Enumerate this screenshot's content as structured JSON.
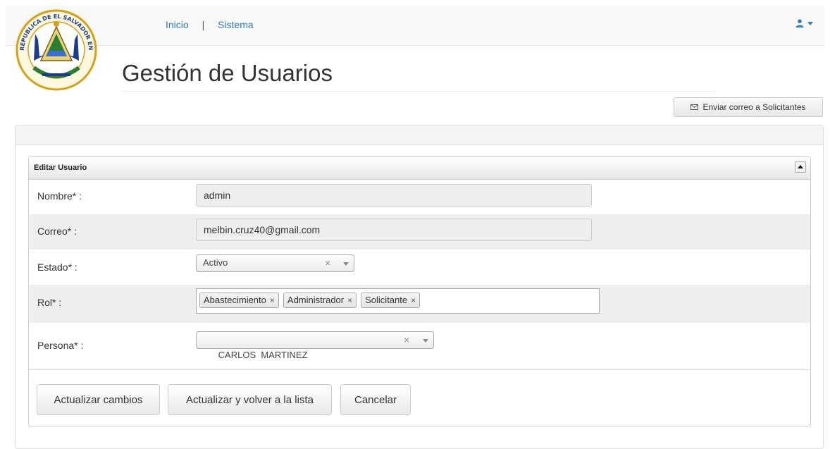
{
  "nav": {
    "items": [
      "Inicio",
      "Sistema"
    ],
    "separator": "|"
  },
  "user_menu": {
    "icon": "user-icon",
    "dropdown_icon": "caret-down-icon"
  },
  "logo": {
    "name": "el-salvador-coat-of-arms",
    "text": "REPUBLICA DE EL SALVADOR EN LA AMERICA CENTRAL"
  },
  "page": {
    "title": "Gestión de Usuarios",
    "email_button": {
      "icon": "envelope-icon",
      "label": "Enviar correo a Solicitantes"
    }
  },
  "form": {
    "header": "Editar Usuario",
    "fields": {
      "nombre": {
        "label": "Nombre* :",
        "value": "admin"
      },
      "correo": {
        "label": "Correo* :",
        "value": "melbin.cruz40@gmail.com"
      },
      "estado": {
        "label": "Estado* :",
        "value": "Activo"
      },
      "rol": {
        "label": "Rol* :",
        "tags": [
          "Abastecimiento",
          "Administrador",
          "Solicitante"
        ]
      },
      "persona": {
        "label": "Persona* :",
        "value": "CARLOS  MARTINEZ"
      }
    },
    "clear_symbol": "×",
    "tag_remove_symbol": "×",
    "buttons": {
      "update": "Actualizar cambios",
      "update_back": "Actualizar y volver a la lista",
      "cancel": "Cancelar"
    }
  },
  "colors": {
    "link": "#337ab7",
    "navbar_bg": "#f8f8f8",
    "row_alt": "#eeeeee",
    "seal_blue": "#1b3c8c",
    "seal_gold": "#d4a017"
  }
}
